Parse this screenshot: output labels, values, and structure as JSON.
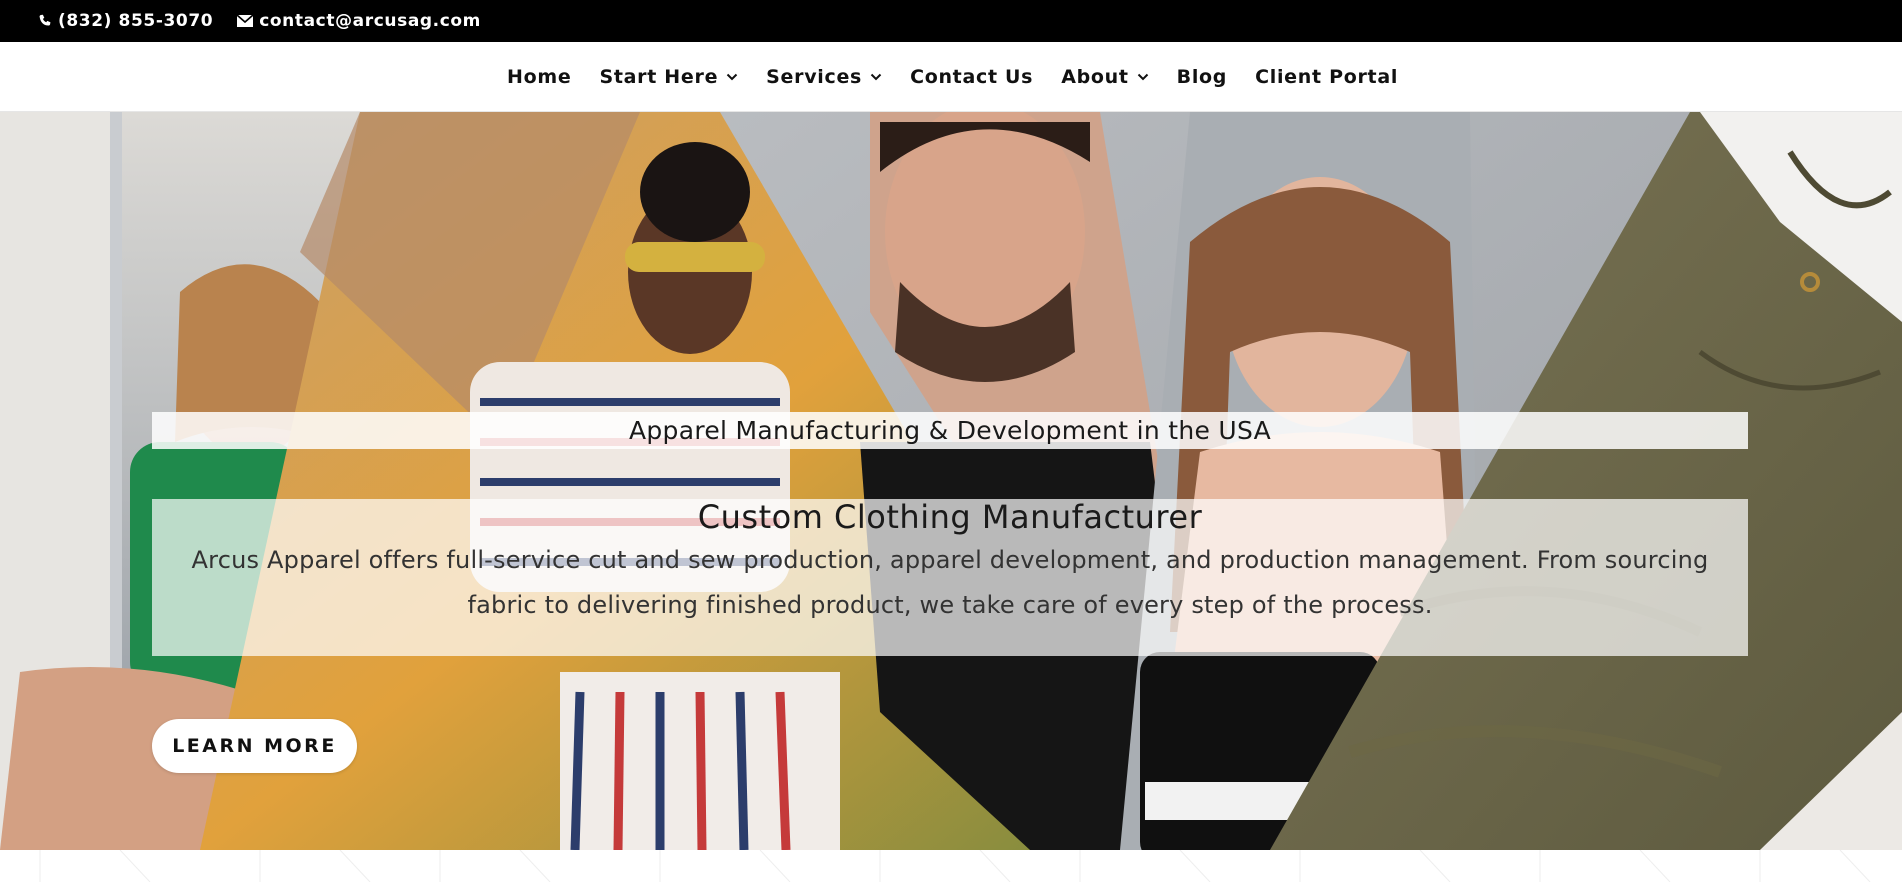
{
  "topbar": {
    "phone": "(832) 855-3070",
    "email": "contact@arcusag.com",
    "phone_icon": "phone-icon",
    "email_icon": "envelope-icon"
  },
  "nav": {
    "items": [
      {
        "label": "Home",
        "has_dropdown": false
      },
      {
        "label": "Start Here",
        "has_dropdown": true
      },
      {
        "label": "Services",
        "has_dropdown": true
      },
      {
        "label": "Contact Us",
        "has_dropdown": false
      },
      {
        "label": "About",
        "has_dropdown": true
      },
      {
        "label": "Blog",
        "has_dropdown": false
      },
      {
        "label": "Client Portal",
        "has_dropdown": false
      }
    ]
  },
  "hero": {
    "subtitle": "Apparel Manufacturing & Development in the USA",
    "heading": "Custom Clothing Manufacturer",
    "description": "Arcus Apparel offers full-service cut and sew production, apparel development, and production management. From sourcing fabric to delivering finished product, we take care of every step of the process.",
    "cta_label": "LEARN MORE"
  },
  "colors": {
    "topbar_bg": "#000000",
    "nav_text": "#111111",
    "accent_olive": "#6e6848"
  }
}
